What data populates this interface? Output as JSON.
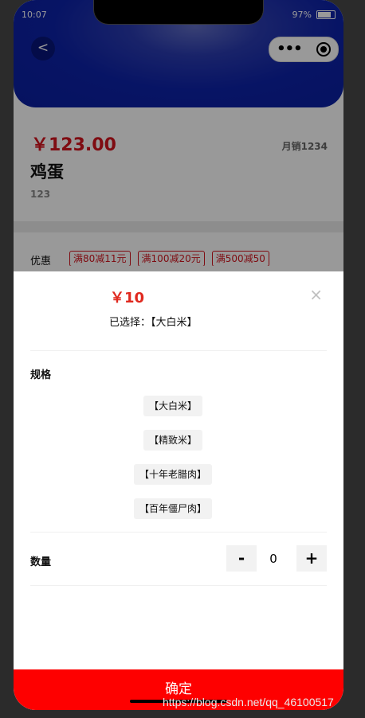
{
  "status_bar": {
    "time": "10:07",
    "battery": "97%"
  },
  "nav": {
    "back_symbol": "<"
  },
  "product": {
    "price": "￥123.00",
    "monthly_sales": "月销1234",
    "name": "鸡蛋",
    "code": "123"
  },
  "promotions": {
    "label": "优惠",
    "tags": [
      "满80减11元",
      "满100减20元",
      "满500减50"
    ]
  },
  "sheet": {
    "price": "￥10",
    "close_symbol": "×",
    "selected_label": "已选择：【大白米】",
    "spec_title": "规格",
    "spec_options": [
      "【大白米】",
      "【精致米】",
      "【十年老腊肉】",
      "【百年僵尸肉】"
    ],
    "quantity_label": "数量",
    "minus_label": "-",
    "quantity_value": "0",
    "plus_label": "+",
    "confirm_label": "确定"
  },
  "watermark": "https://blog.csdn.net/qq_46100517",
  "colors": {
    "hero_blue": "#0d22a8",
    "price_red": "#d4141e",
    "confirm_red": "#fe0000"
  }
}
